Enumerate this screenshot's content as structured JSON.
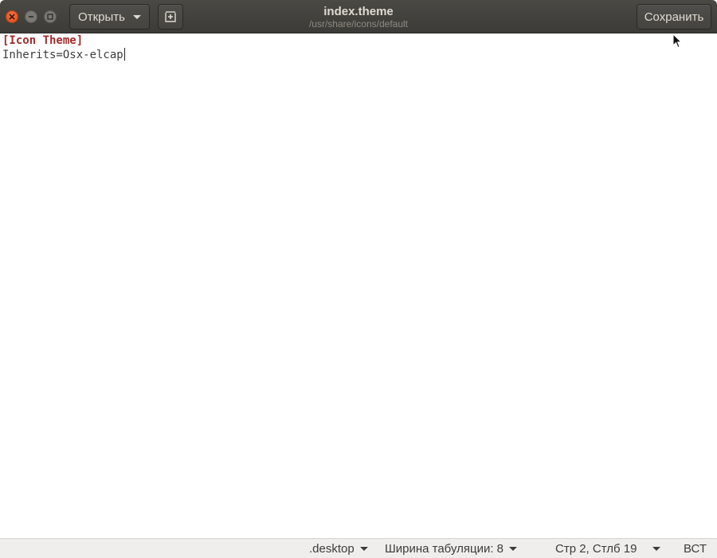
{
  "window": {
    "title": "index.theme",
    "subtitle": "/usr/share/icons/default"
  },
  "toolbar": {
    "open_label": "Открыть",
    "save_label": "Сохранить"
  },
  "editor": {
    "lines": [
      "[Icon Theme]",
      "Inherits=Osx-elcap"
    ]
  },
  "statusbar": {
    "language": ".desktop",
    "tab_width": "Ширина табуляции: 8",
    "position": "Стр 2, Стлб 19",
    "insert_mode": "ВСТ"
  },
  "colors": {
    "titlebar": "#3c3b37",
    "close_button": "#df4a16",
    "section_header": "#a52a2a"
  }
}
